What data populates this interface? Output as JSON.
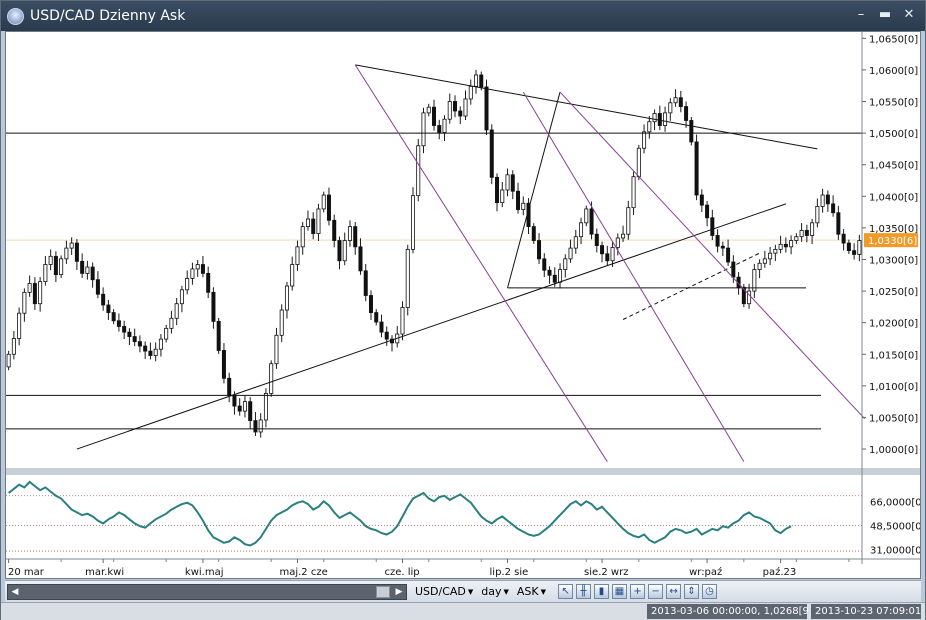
{
  "window": {
    "title": "USD/CAD Dzienny Ask",
    "controls": [
      "–",
      "▬",
      "✕"
    ]
  },
  "chart_data": {
    "type": "candlestick",
    "symbol": "USD/CAD",
    "ylim": [
      0.997,
      1.066
    ],
    "y_ticks": [
      "1,0650[0]",
      "1,0600[0]",
      "1,0550[0]",
      "1,0500[0]",
      "1,0450[0]",
      "1,0400[0]",
      "1,0350[0]",
      "1,0300[0]",
      "1,0250[0]",
      "1,0200[0]",
      "1,0150[0]",
      "1,0100[0]",
      "1,0050[0]",
      "1,0000[0]"
    ],
    "y_tick_values": [
      1.065,
      1.06,
      1.055,
      1.05,
      1.045,
      1.04,
      1.035,
      1.03,
      1.025,
      1.02,
      1.015,
      1.01,
      1.005,
      1.0
    ],
    "current_price": {
      "label": "1,0330[6]",
      "value": 1.03306
    },
    "x_labels": [
      "20 mar",
      "mar.kwi",
      "kwi.maj",
      "maj.2 cze",
      "cze. lip",
      "lip.2 sie",
      "sie.2 wrz",
      "wr:paź",
      "paź.23"
    ],
    "x_label_index": [
      0,
      18,
      37,
      55,
      75,
      95,
      113,
      133,
      147
    ],
    "bar_count": 163,
    "closes": [
      1.015,
      1.0175,
      1.0215,
      1.0248,
      1.0262,
      1.023,
      1.0265,
      1.0292,
      1.0305,
      1.0276,
      1.0301,
      1.0318,
      1.0326,
      1.0297,
      1.0278,
      1.0288,
      1.0268,
      1.0245,
      1.0228,
      1.0216,
      1.0203,
      1.0194,
      1.0185,
      1.0178,
      1.017,
      1.0163,
      1.0155,
      1.0148,
      1.0158,
      1.0174,
      1.0191,
      1.0207,
      1.023,
      1.0252,
      1.027,
      1.0285,
      1.0292,
      1.0278,
      1.0248,
      1.0202,
      1.0156,
      1.0112,
      1.0085,
      1.0068,
      1.006,
      1.0075,
      1.0045,
      1.0027,
      1.0046,
      1.0088,
      1.0135,
      1.018,
      1.022,
      1.0258,
      1.0292,
      1.032,
      1.0352,
      1.0364,
      1.0341,
      1.038,
      1.0402,
      1.0362,
      1.033,
      1.0298,
      1.033,
      1.0352,
      1.032,
      1.0282,
      1.0243,
      1.0216,
      1.0201,
      1.0185,
      1.0174,
      1.0168,
      1.0182,
      1.0224,
      1.0316,
      1.0401,
      1.048,
      1.0532,
      1.0541,
      1.0512,
      1.0501,
      1.0522,
      1.055,
      1.0535,
      1.0527,
      1.0554,
      1.0574,
      1.0592,
      1.0573,
      1.0505,
      1.043,
      1.039,
      1.041,
      1.0434,
      1.0408,
      1.0379,
      1.0389,
      1.0352,
      1.033,
      1.0301,
      1.0283,
      1.0275,
      1.0264,
      1.0284,
      1.0301,
      1.0318,
      1.0336,
      1.0358,
      1.038,
      1.034,
      1.0322,
      1.0309,
      1.0298,
      1.0319,
      1.0334,
      1.034,
      1.0382,
      1.0431,
      1.0476,
      1.0502,
      1.0518,
      1.0531,
      1.0512,
      1.0532,
      1.0548,
      1.0556,
      1.0542,
      1.052,
      1.0486,
      1.0402,
      1.0386,
      1.0366,
      1.0338,
      1.0321,
      1.0318,
      1.0296,
      1.0272,
      1.0256,
      1.023,
      1.025,
      1.0284,
      1.0294,
      1.0301,
      1.031,
      1.0316,
      1.0324,
      1.032,
      1.033,
      1.0336,
      1.0346,
      1.0338,
      1.0358,
      1.0384,
      1.0402,
      1.0388,
      1.0374,
      1.034,
      1.0326,
      1.0314,
      1.0308,
      1.033
    ],
    "lines": {
      "horizontal": [
        1.05,
        1.0255,
        1.0085,
        1.0032
      ],
      "trend": [
        {
          "from": [
            13,
            1.0
          ],
          "to": [
            148,
            1.0388
          ]
        },
        {
          "from": [
            66,
            1.0608
          ],
          "to": [
            154,
            1.0475
          ]
        },
        {
          "from": [
            95,
            1.0255
          ],
          "to": [
            105,
            1.0565
          ]
        },
        {
          "from": [
            117,
            1.0205
          ],
          "to": [
            143,
            1.031
          ]
        }
      ],
      "channel": [
        {
          "from": [
            66,
            1.0608
          ],
          "to": [
            114,
            0.998
          ]
        },
        {
          "from": [
            98,
            1.0565
          ],
          "to": [
            140,
            0.998
          ]
        },
        {
          "from": [
            105,
            1.0565
          ],
          "to": [
            163,
            1.0048
          ]
        }
      ]
    },
    "oscillator": {
      "ylim": [
        25,
        85
      ],
      "y_ticks": [
        "66,0000[0",
        "48,5000[0",
        "31,0000[0"
      ],
      "y_tick_values": [
        66,
        48.5,
        31
      ],
      "levels": [
        70,
        48.5,
        30
      ],
      "values": [
        72,
        75,
        78,
        76,
        80,
        77,
        74,
        76,
        73,
        70,
        68,
        64,
        60,
        58,
        56,
        57,
        55,
        52,
        50,
        53,
        55,
        58,
        56,
        53,
        50,
        48,
        47,
        50,
        53,
        55,
        57,
        60,
        62,
        64,
        65,
        63,
        58,
        52,
        45,
        40,
        38,
        36,
        37,
        40,
        38,
        35,
        34,
        36,
        40,
        46,
        52,
        56,
        58,
        60,
        63,
        65,
        66,
        64,
        60,
        62,
        66,
        63,
        58,
        54,
        56,
        58,
        55,
        52,
        48,
        46,
        45,
        43,
        42,
        44,
        48,
        55,
        62,
        68,
        70,
        72,
        68,
        66,
        69,
        70,
        67,
        69,
        71,
        68,
        65,
        60,
        55,
        52,
        50,
        53,
        55,
        52,
        49,
        46,
        44,
        42,
        41,
        42,
        45,
        48,
        52,
        56,
        60,
        64,
        66,
        63,
        66,
        64,
        60,
        62,
        58,
        54,
        50,
        46,
        43,
        41,
        40,
        42,
        38,
        36,
        38,
        40,
        44,
        46,
        45,
        43,
        44,
        46,
        42,
        44,
        46,
        45,
        48,
        47,
        50,
        52,
        56,
        58,
        55,
        54,
        52,
        50,
        45,
        43,
        46,
        48
      ]
    }
  },
  "toolbar": {
    "symbol": "USD/CAD",
    "timeframe": "day",
    "side": "ASK",
    "icons": [
      "cursor-icon",
      "bar-type-icon",
      "candle-icon",
      "grid-icon",
      "zoom-in-icon",
      "zoom-out-icon",
      "shift-icon",
      "fit-icon",
      "period-icon"
    ]
  },
  "status": {
    "cursor_time": "2013-03-06 00:00:00",
    "cursor_value": "1,0268[9]",
    "server_time": "2013-10-23 07:09:01"
  }
}
